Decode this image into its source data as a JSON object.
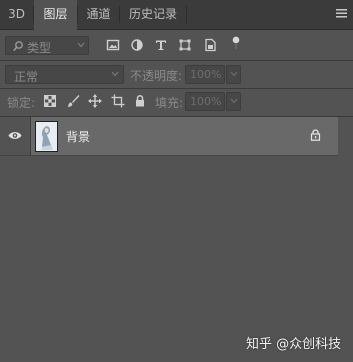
{
  "tabs": [
    {
      "label": "3D",
      "active": false
    },
    {
      "label": "图层",
      "active": true
    },
    {
      "label": "通道",
      "active": false
    },
    {
      "label": "历史记录",
      "active": false
    }
  ],
  "filter": {
    "kind_label": "类型",
    "icons": [
      "image-filter-icon",
      "adjustment-filter-icon",
      "type-filter-icon",
      "shape-filter-icon",
      "smart-object-filter-icon",
      "filter-toggle-icon"
    ]
  },
  "blend": {
    "mode": "正常",
    "opacity_label": "不透明度:",
    "opacity_value": "100%"
  },
  "lock": {
    "label": "锁定:",
    "icons": [
      "lock-transparent-icon",
      "lock-image-icon",
      "lock-position-icon",
      "lock-artboard-icon",
      "lock-all-icon"
    ],
    "fill_label": "填充:",
    "fill_value": "100%"
  },
  "layers": [
    {
      "name": "背景",
      "visible": true,
      "locked": true
    }
  ],
  "watermark": "知乎 @众创科技",
  "colors": {
    "panel_bg": "#535353",
    "tabbar_bg": "#3b3b3b",
    "selected_layer_bg": "#696969"
  }
}
